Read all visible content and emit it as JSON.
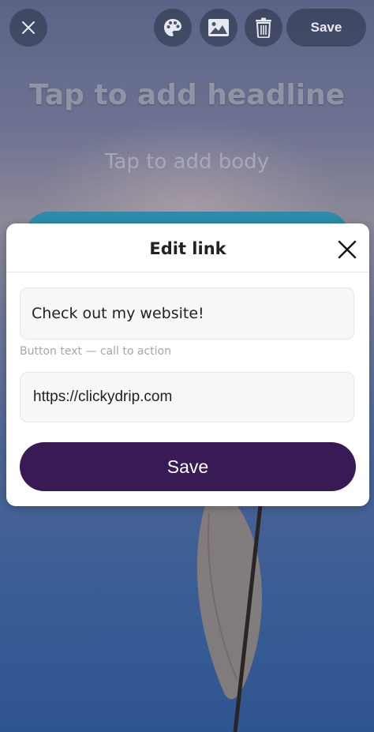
{
  "toolbar": {
    "close_icon": "close-icon",
    "palette_icon": "palette-icon",
    "image_icon": "image-icon",
    "delete_icon": "trash-icon",
    "save_label": "Save"
  },
  "canvas": {
    "headline_placeholder": "Tap to add headline",
    "body_placeholder": "Tap to add body",
    "link_button_color": "#2d8aa9"
  },
  "modal": {
    "title": "Edit link",
    "close_icon": "close-icon",
    "button_text_value": "Check out my website!",
    "button_text_helper": "Button text — call to action",
    "url_value": "https://clickydrip.com",
    "save_label": "Save",
    "save_color": "#3a1a55"
  }
}
